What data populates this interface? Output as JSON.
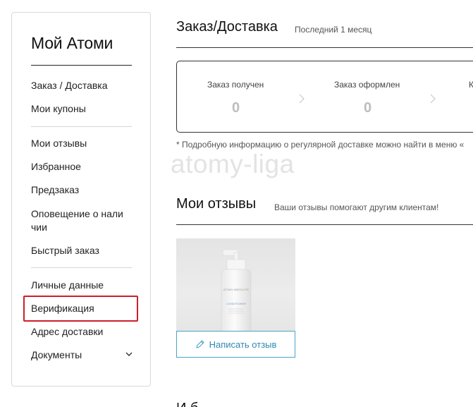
{
  "sidebar": {
    "title": "Мой Атоми",
    "groups": [
      [
        "Заказ / Доставка",
        "Мои купоны"
      ],
      [
        "Мои отзывы",
        "Избранное",
        "Предзаказ",
        "Оповещение о нали чии",
        "Быстрый заказ"
      ],
      [
        "Личные данные",
        "Верификация",
        "Адрес доставки",
        "Документы"
      ]
    ],
    "highlighted_item": "Верификация",
    "highlight_color": "#cc1f2a"
  },
  "orders": {
    "title": "Заказ/Доставка",
    "subtitle": "Последний 1 месяц",
    "statuses": [
      {
        "label": "Заказ получен",
        "count": "0"
      },
      {
        "label": "Заказ оформлен",
        "count": "0"
      },
      {
        "label": "К",
        "count": ""
      }
    ],
    "note": "* Подробную информацию о регулярной доставке можно найти в меню «"
  },
  "watermark": "atomy-liga",
  "reviews": {
    "title": "Мои отзывы",
    "subtitle": "Ваши отзывы помогают другим клиентам!",
    "product": {
      "brand_text": "ATOMY ABSOLUTE",
      "product_text": "CONDITIONER",
      "write_review_label": "Написать отзыв"
    }
  },
  "next_section_partial": "И б",
  "colors": {
    "accent": "#2d8ab3",
    "accent_border": "#4aa3c6",
    "status_zero": "#bdbdbd"
  }
}
